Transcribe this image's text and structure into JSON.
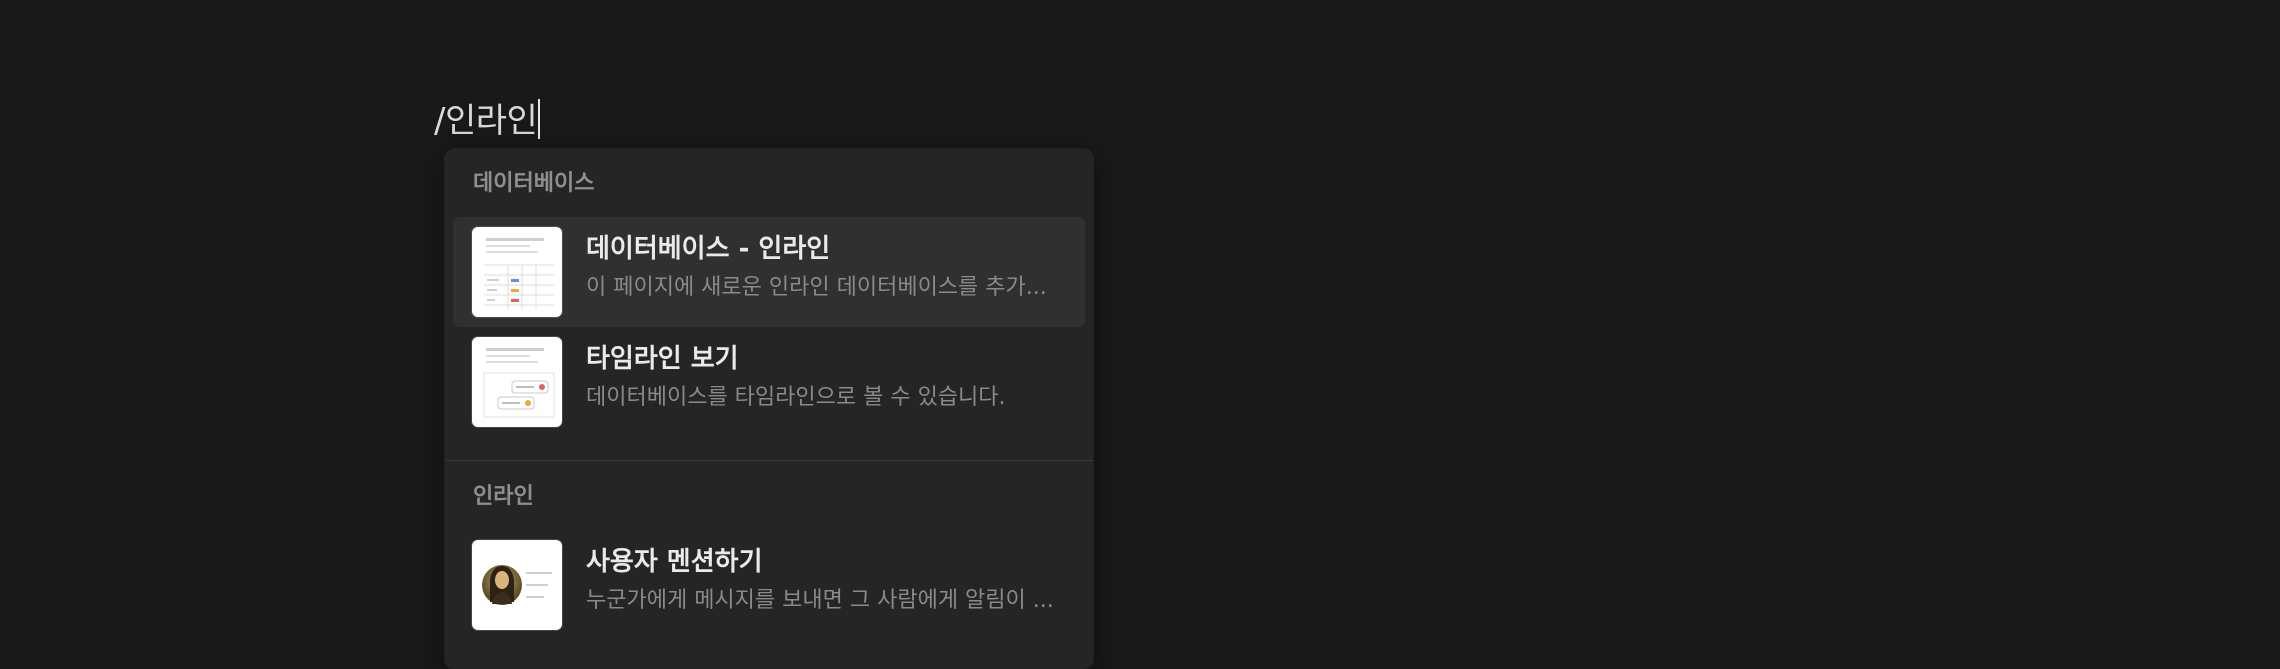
{
  "command_input": {
    "value": "/인라인"
  },
  "menu": {
    "sections": [
      {
        "title": "데이터베이스",
        "items": [
          {
            "title": "데이터베이스 - 인라인",
            "description": "이 페이지에 새로운 인라인 데이터베이스를 추가...",
            "icon": "table-preview-icon",
            "selected": true
          },
          {
            "title": "타임라인 보기",
            "description": "데이터베이스를 타임라인으로 볼 수 있습니다.",
            "icon": "timeline-preview-icon",
            "selected": false
          }
        ]
      },
      {
        "title": "인라인",
        "items": [
          {
            "title": "사용자 멘션하기",
            "description": "누군가에게 메시지를 보내면 그 사람에게 알림이 ...",
            "icon": "mention-preview-icon",
            "selected": false
          }
        ]
      }
    ]
  },
  "colors": {
    "background": "#191919",
    "menu_background": "#252525",
    "selected_item": "#303030",
    "accent_blue": "#5b8def",
    "accent_orange": "#f0a73a",
    "accent_red": "#e0605a"
  }
}
